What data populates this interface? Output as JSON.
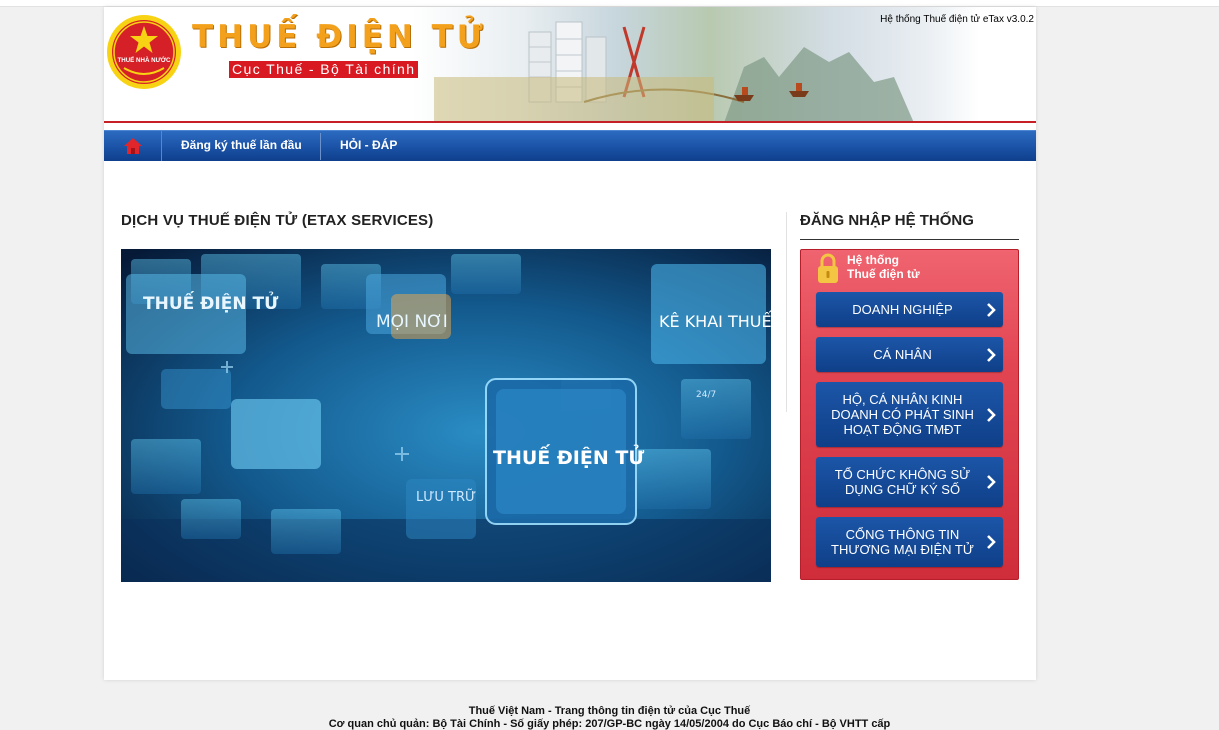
{
  "header": {
    "version": "Hệ thống Thuế điện tử eTax v3.0.2",
    "site_title": "THUẾ ĐIỆN TỬ",
    "site_subtitle": "Cục Thuế - Bộ Tài chính",
    "emblem_text": "THUẾ NHÀ NƯỚC"
  },
  "nav": {
    "home_icon": "home-icon",
    "items": [
      {
        "label": "Đăng ký thuế lần đầu"
      },
      {
        "label": "HỎI - ĐÁP"
      }
    ]
  },
  "main": {
    "section_title": "DỊCH VỤ THUẾ ĐIỆN TỬ (ETAX SERVICES)",
    "banner": {
      "texts": [
        "THUẾ ĐIỆN TỬ",
        "MỌI NƠI",
        "KÊ KHAI THUẾ",
        "THUẾ ĐIỆN TỬ",
        "LƯU TRỮ",
        "24/7"
      ]
    }
  },
  "login": {
    "title": "ĐĂNG NHẬP HỆ THỐNG",
    "panel_heading_line1": "Hệ thống",
    "panel_heading_line2": "Thuế điện tử",
    "buttons": [
      {
        "label": "DOANH NGHIỆP"
      },
      {
        "label": "CÁ NHÂN"
      },
      {
        "label": "HỘ, CÁ NHÂN KINH DOANH CÓ PHÁT SINH HOẠT ĐỘNG TMĐT"
      },
      {
        "label": "TỔ CHỨC KHÔNG SỬ DỤNG CHỮ KÝ SỐ"
      },
      {
        "label": "CỔNG THÔNG TIN THƯƠNG MẠI ĐIỆN TỬ"
      }
    ]
  },
  "footer": {
    "line1": "Thuế Việt Nam - Trang thông tin điện tử của Cục Thuế",
    "line2": "Cơ quan chủ quản: Bộ Tài Chính - Số giấy phép: 207/GP-BC ngày 14/05/2004 do Cục Báo chí - Bộ VHTT cấp"
  },
  "colors": {
    "nav_blue": "#1a52a6",
    "login_red": "#e24552",
    "button_blue": "#0f3f88",
    "title_orange": "#f3a11c",
    "subtitle_red": "#d81921"
  }
}
